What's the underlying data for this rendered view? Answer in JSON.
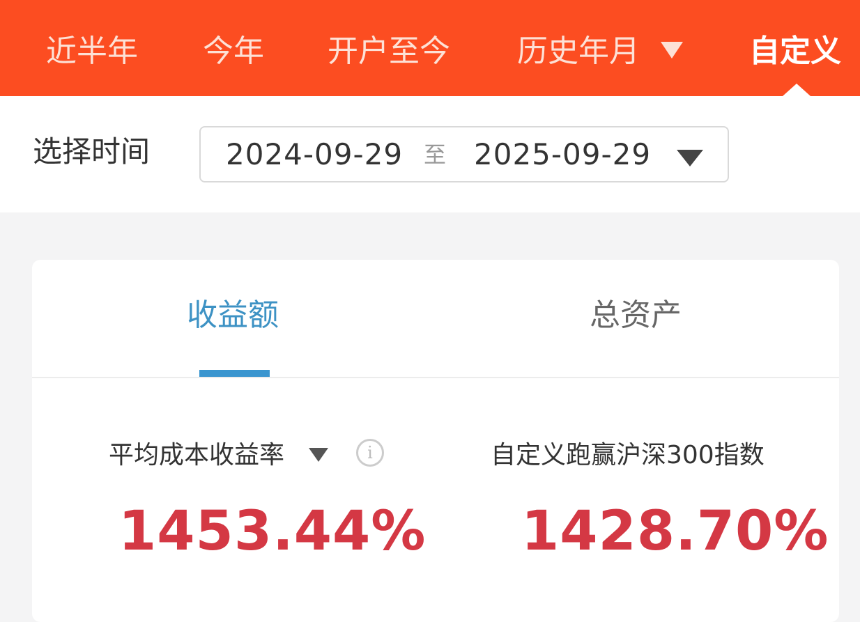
{
  "top_tabs": {
    "items": [
      {
        "label": "近半年",
        "active": false
      },
      {
        "label": "今年",
        "active": false
      },
      {
        "label": "开户至今",
        "active": false
      },
      {
        "label": "历史年月",
        "active": false,
        "has_dropdown": true
      },
      {
        "label": "自定义",
        "active": true
      }
    ],
    "bar_color": "#fc4d21"
  },
  "date_selector": {
    "label": "选择时间",
    "start_date": "2024-09-29",
    "separator": "至",
    "end_date": "2025-09-29",
    "dropdown_icon": "caret-down-icon"
  },
  "card": {
    "tabs": [
      {
        "label": "收益额",
        "active": true
      },
      {
        "label": "总资产",
        "active": false
      }
    ],
    "active_color": "#3a95cf",
    "stats": {
      "left": {
        "label": "平均成本收益率",
        "value": "1453.44%",
        "has_dropdown": true,
        "info_icon": "info-circle-icon",
        "info_glyph": "i"
      },
      "right": {
        "label": "自定义跑赢沪深300指数",
        "value": "1428.70%"
      }
    },
    "value_color": "#d43844"
  }
}
